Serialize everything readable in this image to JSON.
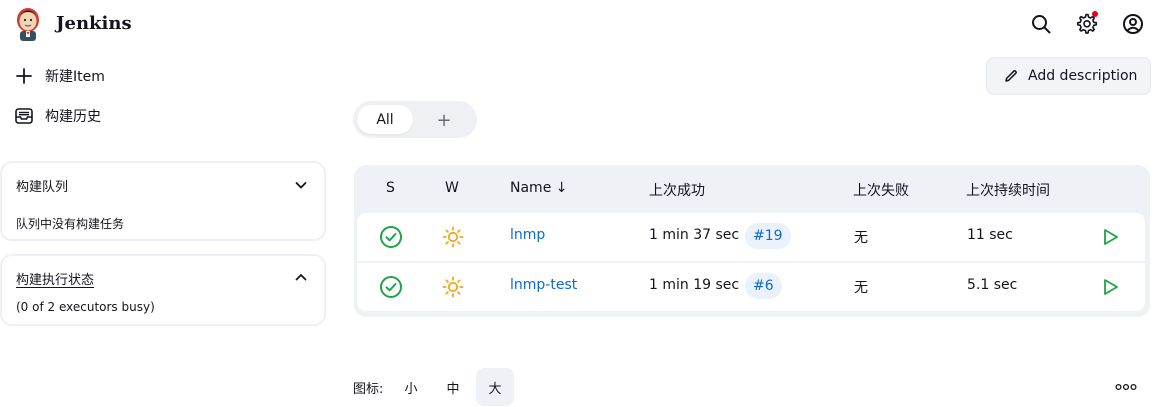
{
  "header": {
    "app_title": "Jenkins",
    "icons": [
      "search-icon",
      "gear-icon",
      "user-icon"
    ],
    "notification_color": "#e6001f"
  },
  "sidebar": {
    "new_item": {
      "label": "新建Item",
      "icon": "plus-icon"
    },
    "build_history": {
      "label": "构建历史",
      "icon": "inbox-icon"
    },
    "build_queue": {
      "title": "构建队列",
      "body": "队列中没有构建任务",
      "expanded": false
    },
    "executor_status": {
      "title": "构建执行状态",
      "body": "(0 of 2 executors busy)",
      "expanded": true
    }
  },
  "main": {
    "add_description_label": "Add description",
    "tabs": {
      "active": "All",
      "add": "+"
    },
    "table": {
      "columns": {
        "status": "S",
        "weather": "W",
        "name": "Name ↓",
        "last_success": "上次成功",
        "last_failure": "上次失败",
        "last_duration": "上次持续时间"
      },
      "rows": [
        {
          "name": "lnmp",
          "last_success": "1 min 37 sec",
          "build": "#19",
          "last_failure": "无",
          "last_duration": "11 sec",
          "status": "success",
          "weather": "sunny"
        },
        {
          "name": "lnmp-test",
          "last_success": "1 min 19 sec",
          "build": "#6",
          "last_failure": "无",
          "last_duration": "5.1 sec",
          "status": "success",
          "weather": "sunny"
        }
      ]
    },
    "icon_legend": {
      "label": "图标:",
      "sizes": [
        "小",
        "中",
        "大"
      ],
      "selected": "大"
    }
  },
  "colors": {
    "accent": "#0b6bcb",
    "success": "#1ea446",
    "weather": "#f0a81c",
    "table_bg": "#eef1f5"
  }
}
